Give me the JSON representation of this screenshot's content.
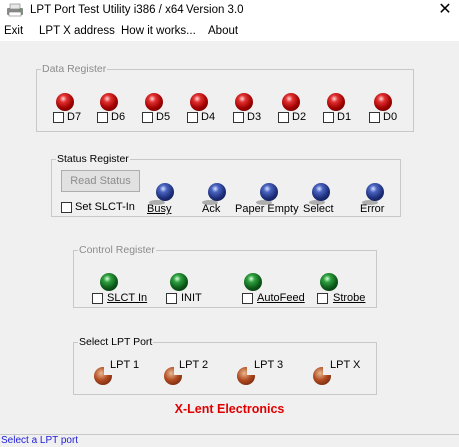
{
  "window": {
    "title": "LPT Port Test Utility i386 / x64",
    "version": "Version 3.0",
    "close_glyph": "✕"
  },
  "menu": [
    "Exit",
    "LPT X address",
    "How it works...",
    "About"
  ],
  "data_register": {
    "title": "Data Register",
    "bits": [
      {
        "label": "D7",
        "led": "red",
        "checked": false
      },
      {
        "label": "D6",
        "led": "red",
        "checked": false
      },
      {
        "label": "D5",
        "led": "red",
        "checked": false
      },
      {
        "label": "D4",
        "led": "red",
        "checked": false
      },
      {
        "label": "D3",
        "led": "red",
        "checked": false
      },
      {
        "label": "D2",
        "led": "red",
        "checked": false
      },
      {
        "label": "D1",
        "led": "red",
        "checked": false
      },
      {
        "label": "D0",
        "led": "red",
        "checked": false
      }
    ]
  },
  "status_register": {
    "title": "Status Register",
    "read_button": "Read Status",
    "set_checkbox": "Set SLCT-In",
    "bits": [
      {
        "label": "Busy",
        "led": "blue"
      },
      {
        "label": "Ack",
        "led": "blue"
      },
      {
        "label": "Paper Empty",
        "led": "blue"
      },
      {
        "label": "Select",
        "led": "blue"
      },
      {
        "label": "Error",
        "led": "blue"
      }
    ]
  },
  "control_register": {
    "title": "Control Register",
    "bits": [
      {
        "label": "SLCT In",
        "led": "green",
        "checked": false
      },
      {
        "label": "INIT",
        "led": "green",
        "checked": false
      },
      {
        "label": "AutoFeed",
        "led": "green",
        "checked": false
      },
      {
        "label": "Strobe",
        "led": "green",
        "checked": false
      }
    ]
  },
  "select_port": {
    "title": "Select LPT Port",
    "ports": [
      "LPT 1",
      "LPT 2",
      "LPT 3",
      "LPT X"
    ]
  },
  "brand": "X-Lent Electronics",
  "status_bar": "Select a LPT port",
  "colors": {
    "brand": "#e00000",
    "status_text": "#1c1cd8",
    "led_data": "#c01010",
    "led_status": "#2a3c96",
    "led_control": "#1a7a2a"
  }
}
